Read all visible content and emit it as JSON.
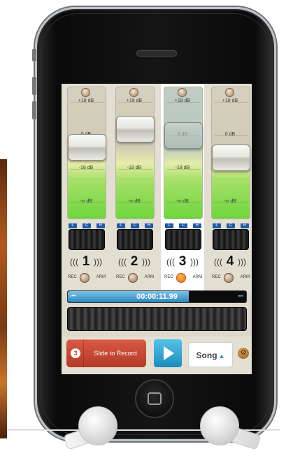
{
  "channels": [
    {
      "number": "1",
      "db_top": "+18 dB",
      "db_zero": "0 dB",
      "db_mid": "-18 dB",
      "db_min": "-∞ dB",
      "fader_level": 0.55,
      "selected": false
    },
    {
      "number": "2",
      "db_top": "+18 dB",
      "db_zero": "0 dB",
      "db_mid": "-18 dB",
      "db_min": "-∞ dB",
      "fader_level": 0.72,
      "selected": false
    },
    {
      "number": "3",
      "db_top": "+18 dB",
      "db_zero": "0 dB",
      "db_mid": "-18 dB",
      "db_min": "-∞ dB",
      "fader_level": 0.66,
      "selected": true
    },
    {
      "number": "4",
      "db_top": "+18 dB",
      "db_zero": "0 dB",
      "db_mid": "-18 dB",
      "db_min": "-∞ dB",
      "fader_level": 0.45,
      "selected": false
    }
  ],
  "pan_labels": {
    "left": "L",
    "center": "C",
    "right": "R"
  },
  "rec_label": "REC",
  "arm_label": "ARM",
  "transport": {
    "time": "00:00:11.99",
    "progress": 0.68,
    "rewind_icon": "skip-back-icon",
    "forward_icon": "skip-forward-icon"
  },
  "controls": {
    "record_count": "3",
    "slide_label": "Slide to Record",
    "play_icon": "play-icon",
    "song_label": "Song",
    "song_arrow": "▲",
    "settings_icon": "gear-icon"
  },
  "colors": {
    "record_accent": "#c24230",
    "play_accent": "#1a8cc0",
    "level_green": "#6ed63c",
    "armed_orange": "#e8700c"
  }
}
